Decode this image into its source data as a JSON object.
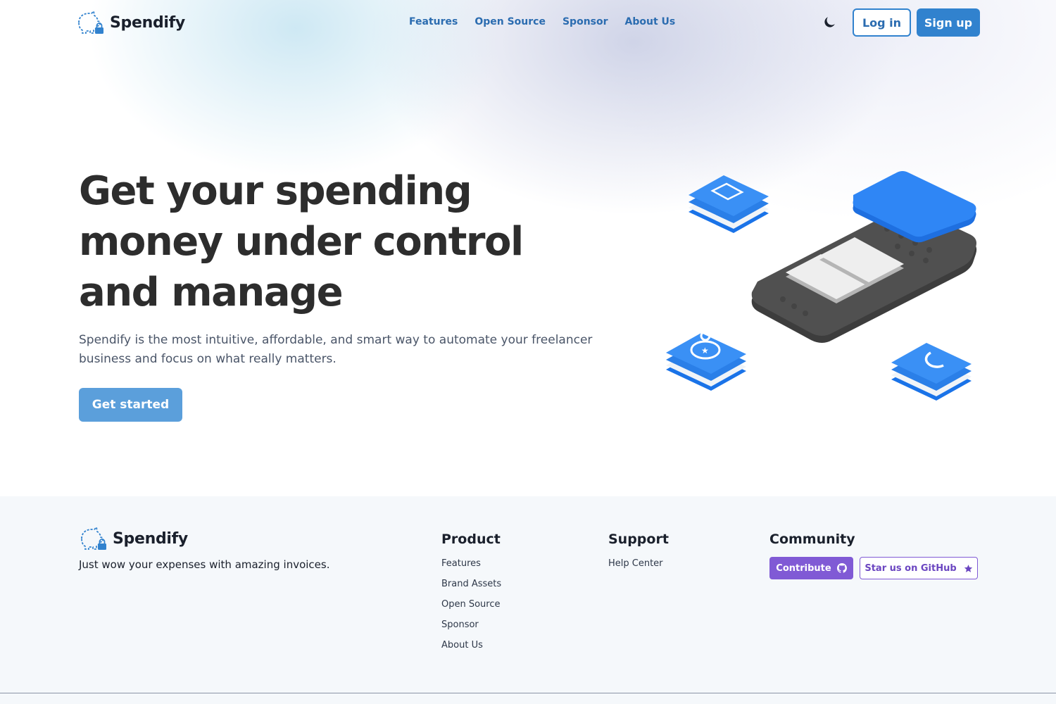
{
  "brand": {
    "name": "Spendify",
    "accent": "#3182ce",
    "community_accent": "#805ad5"
  },
  "header": {
    "nav": [
      "Features",
      "Open Source",
      "Sponsor",
      "About Us"
    ],
    "theme_toggle_icon": "moon-icon",
    "login_label": "Log in",
    "signup_label": "Sign up"
  },
  "hero": {
    "title_lines": [
      "Get your spending",
      "money under control",
      "and manage"
    ],
    "description": "Spendify is the most intuitive, affordable, and smart way to automate your freelancer business and focus on what really matters.",
    "cta_label": "Get started"
  },
  "footer": {
    "tagline": "Just wow your expenses with amazing invoices.",
    "product": {
      "heading": "Product",
      "links": [
        "Features",
        "Brand Assets",
        "Open Source",
        "Sponsor",
        "About Us"
      ]
    },
    "support": {
      "heading": "Support",
      "links": [
        "Help Center"
      ]
    },
    "community": {
      "heading": "Community",
      "contribute_label": "Contribute",
      "contribute_icon": "github-icon",
      "star_label": "Star us on GitHub",
      "star_icon": "star-icon"
    }
  }
}
